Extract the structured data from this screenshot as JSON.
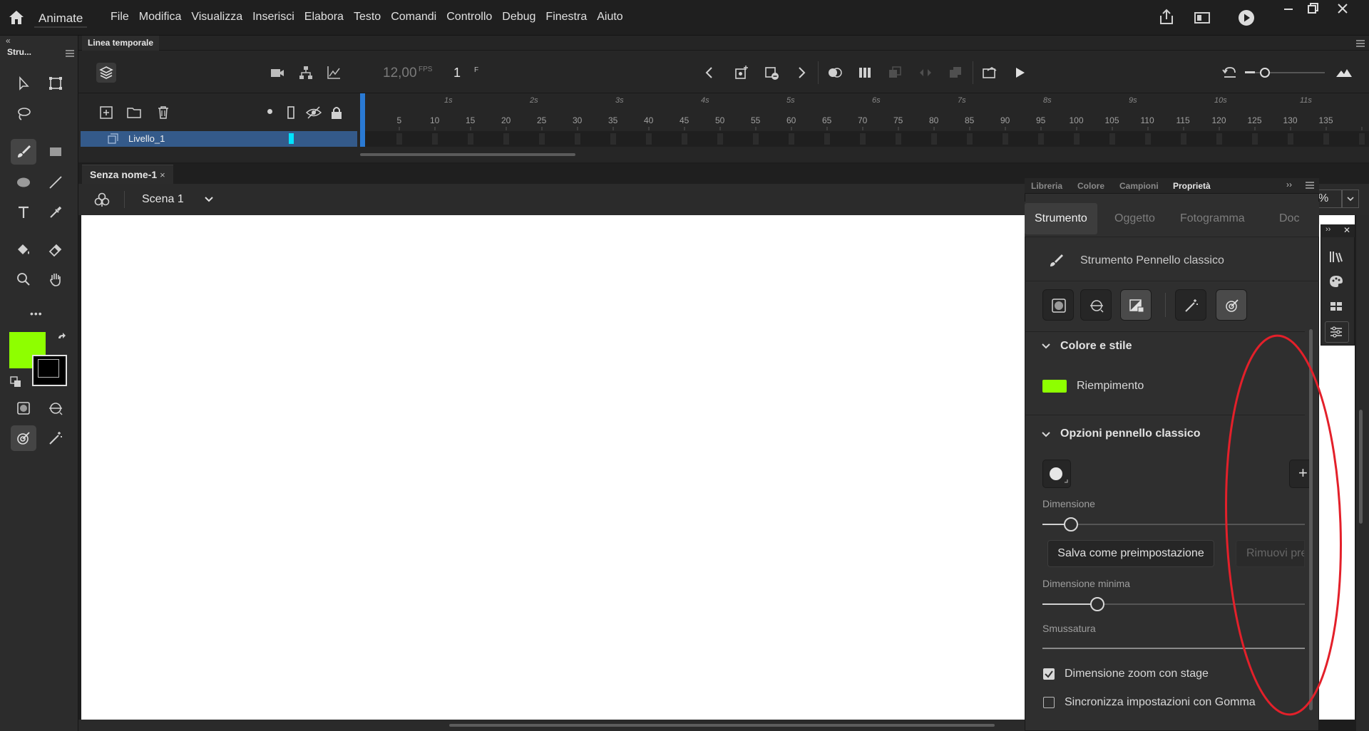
{
  "app": {
    "name": "Animate",
    "menu": [
      "File",
      "Modifica",
      "Visualizza",
      "Inserisci",
      "Elabora",
      "Testo",
      "Comandi",
      "Controllo",
      "Debug",
      "Finestra",
      "Aiuto"
    ]
  },
  "tools_panel": {
    "tab_label": "Stru...",
    "collapse_label": "«",
    "more_label": "•••",
    "stroke_color": "#000000",
    "fill_color": "#8eff00"
  },
  "timeline": {
    "tab_label": "Linea temporale",
    "fps_value": "12,00",
    "fps_unit": "FPS",
    "frame_value": "1",
    "frame_unit": "F",
    "layer_name": "Livello_1",
    "layer_color": "#00e3ff",
    "seconds": [
      "1s",
      "2s",
      "3s",
      "4s",
      "5s",
      "6s",
      "7s",
      "8s",
      "9s",
      "10s",
      "11s"
    ],
    "frames": [
      "5",
      "10",
      "15",
      "20",
      "25",
      "30",
      "35",
      "40",
      "45",
      "50",
      "55",
      "60",
      "65",
      "70",
      "75",
      "80",
      "85",
      "90",
      "95",
      "100",
      "105",
      "110",
      "115",
      "120",
      "125",
      "130",
      "135"
    ]
  },
  "document": {
    "tab_label": "Senza nome-1",
    "tab_close": "×",
    "scene_name": "Scena 1",
    "zoom_value": "%"
  },
  "properties": {
    "tabs": [
      "Libreria",
      "Colore",
      "Campioni",
      "Proprietà"
    ],
    "expand_label": "››",
    "subtabs": [
      "Strumento",
      "Oggetto",
      "Fotogramma",
      "Doc"
    ],
    "tool_name": "Strumento Pennello classico",
    "section_color": "Colore e stile",
    "fill_label": "Riempimento",
    "fill_color": "#8eff00",
    "section_brush": "Opzioni pennello classico",
    "add_preset_label": "+",
    "size_label": "Dimensione",
    "size_value": 0.11,
    "save_preset_label": "Salva come preimpostazione",
    "remove_preset_label": "Rimuovi pre",
    "min_size_label": "Dimensione minima",
    "min_size_value": 0.21,
    "smoothing_label": "Smussatura",
    "zoom_with_stage_label": "Dimensione zoom con stage",
    "zoom_with_stage_checked": true,
    "sync_eraser_label": "Sincronizza impostazioni con Gomma",
    "sync_eraser_checked": false
  },
  "mini_panel": {
    "expand_label": "››",
    "close_label": "✕"
  },
  "annotation_color": "#e3202a"
}
